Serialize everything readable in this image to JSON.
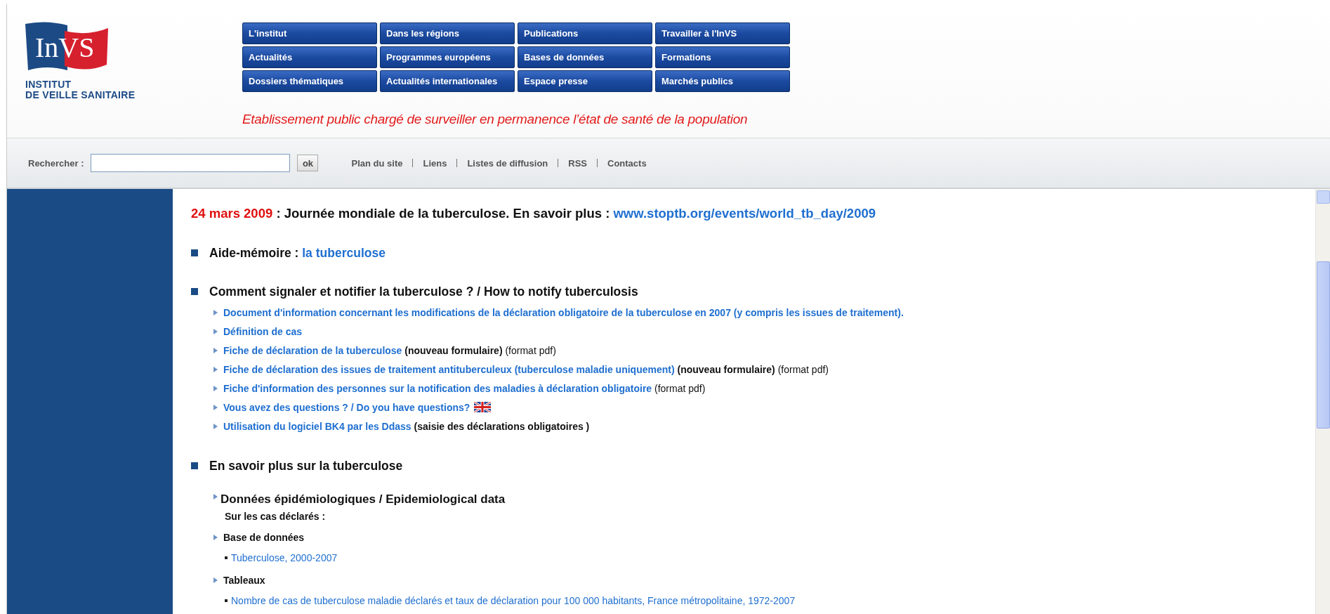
{
  "logo": {
    "abbr": "InVS",
    "name_lines": [
      "INSTITUT",
      "DE VEILLE SANITAIRE"
    ]
  },
  "nav": [
    "L'institut",
    "Dans les régions",
    "Publications",
    "Travailler à l'InVS",
    "Actualités",
    "Programmes européens",
    "Bases de données",
    "Formations",
    "Dossiers thématiques",
    "Actualités internationales",
    "Espace presse",
    "Marchés publics"
  ],
  "tagline": "Etablissement public chargé de surveiller en permanence l’état de santé de la population",
  "search": {
    "label": "Rechercher :",
    "button": "ok"
  },
  "links": [
    "Plan du site",
    "Liens",
    "Listes de diffusion",
    "RSS",
    "Contacts"
  ],
  "announcement": {
    "date": "24 mars 2009",
    "text": " : Journée mondiale de la tuberculose. En savoir plus : ",
    "link": "www.stoptb.org/events/world_tb_day/2009"
  },
  "sections": [
    {
      "title": [
        {
          "text": "Aide-mémoire : ",
          "kind": "plain"
        },
        {
          "text": "la tuberculose",
          "kind": "link"
        }
      ]
    },
    {
      "title": [
        {
          "text": "Comment signaler et notifier la tuberculose ? / How to notify tuberculosis",
          "kind": "plain"
        }
      ],
      "items": [
        {
          "kind": "link",
          "parts": [
            {
              "text": "Document d'information concernant les modifications de la déclaration obligatoire de la tuberculose en 2007 (y compris les issues de traitement).",
              "kind": "link"
            }
          ]
        },
        {
          "kind": "link",
          "parts": [
            {
              "text": "Définition de cas",
              "kind": "link"
            }
          ]
        },
        {
          "kind": "link",
          "parts": [
            {
              "text": "Fiche de déclaration de la tuberculose",
              "kind": "link"
            },
            {
              "text": " (nouveau formulaire)",
              "kind": "bold"
            },
            {
              "text": " (format pdf)",
              "kind": "plain"
            }
          ]
        },
        {
          "kind": "link",
          "parts": [
            {
              "text": "Fiche de déclaration des issues de traitement antituberculeux (tuberculose maladie uniquement)",
              "kind": "link"
            },
            {
              "text": " (nouveau formulaire)",
              "kind": "bold"
            },
            {
              "text": " (format pdf)",
              "kind": "plain"
            }
          ]
        },
        {
          "kind": "link",
          "parts": [
            {
              "text": "Fiche d'information des personnes sur la notification des maladies à déclaration obligatoire",
              "kind": "link"
            },
            {
              "text": " (format pdf)",
              "kind": "plain"
            }
          ]
        },
        {
          "kind": "link",
          "flag": true,
          "parts": [
            {
              "text": "Vous avez des questions ? / Do you have questions?",
              "kind": "link"
            }
          ]
        },
        {
          "kind": "link",
          "parts": [
            {
              "text": "Utilisation du logiciel BK4 par les Ddass",
              "kind": "link"
            },
            {
              "text": " (saisie des déclarations obligatoires )",
              "kind": "bold"
            }
          ]
        }
      ]
    },
    {
      "title": [
        {
          "text": "En savoir plus sur la tuberculose",
          "kind": "plain"
        }
      ],
      "items": [
        {
          "kind": "subheading",
          "parts": [
            {
              "text": "Données épidémiologiques / Epidemiological data",
              "kind": "bold"
            }
          ]
        },
        {
          "kind": "note",
          "parts": [
            {
              "text": "Sur les cas déclarés :",
              "kind": "bold"
            }
          ]
        },
        {
          "kind": "group",
          "parts": [
            {
              "text": "Base de données",
              "kind": "bold"
            }
          ]
        },
        {
          "kind": "entry",
          "parts": [
            {
              "text": "Tuberculose, 2000-2007",
              "kind": "link"
            }
          ]
        },
        {
          "kind": "group",
          "parts": [
            {
              "text": "Tableaux",
              "kind": "bold"
            }
          ]
        },
        {
          "kind": "entry",
          "parts": [
            {
              "text": "Nombre de cas de tuberculose maladie déclarés et taux de déclaration pour 100 000 habitants, France métropolitaine, 1972-2007",
              "kind": "link"
            }
          ]
        }
      ]
    }
  ]
}
